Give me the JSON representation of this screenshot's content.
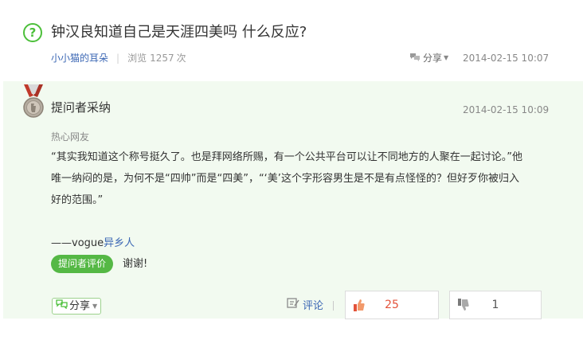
{
  "question": {
    "title": "钟汉良知道自己是天涯四美吗 什么反应?",
    "icon": "question-circle-icon",
    "asker": "小小猫的耳朵",
    "views_label": "浏览",
    "views_count": "1257",
    "views_unit": "次",
    "share_label": "分享",
    "date": "2014-02-15 10:07"
  },
  "answer": {
    "adopted_title": "提问者采纳",
    "date": "2014-02-15 10:09",
    "answerer": "热心网友",
    "paragraph": "“其实我知道这个称号挺久了。也是拜网络所赐，有一个公共平台可以让不同地方的人聚在一起讨论。”他唯一纳闷的是，为何不是“四帅”而是“四美”，“‘美’这个字形容男生是不是有点怪怪的？但好歹你被归入好的范围。”",
    "signature_prefix": "——vogue",
    "signature_link": "异乡人",
    "eval_button": "提问者评价",
    "eval_text": "谢谢!",
    "share_label": "分享",
    "comment_label": "评论",
    "upvotes": "25",
    "downvotes": "1"
  },
  "colors": {
    "accent_green": "#4cbf3a",
    "link_blue": "#3b67b4",
    "panel_bg": "#f2faf0",
    "upvote_red": "#e3523a"
  }
}
